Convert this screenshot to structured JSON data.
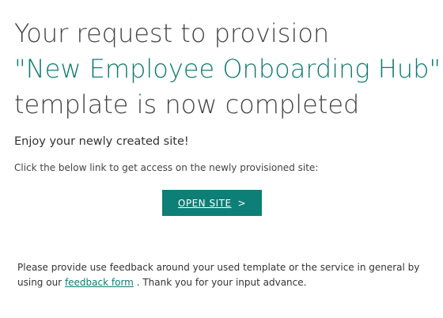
{
  "headline": {
    "line1": "Your request to provision",
    "template_name": "\"New Employee Onboarding Hub\"",
    "line3": "template is now completed"
  },
  "enjoy_text": "Enjoy your newly created site!",
  "instruction_text": "Click the below link to get access on the newly provisioned site:",
  "open_site_button": {
    "label": "OPEN SITE",
    "chevron": ">"
  },
  "feedback": {
    "text_before": "Please provide use feedback around your used template or the service in general by using our",
    "link_text": "feedback form",
    "text_after": ". Thank you for your input advance."
  },
  "colors": {
    "accent": "#0f7b73",
    "button_bg": "#0d7f76",
    "text": "#333333"
  }
}
